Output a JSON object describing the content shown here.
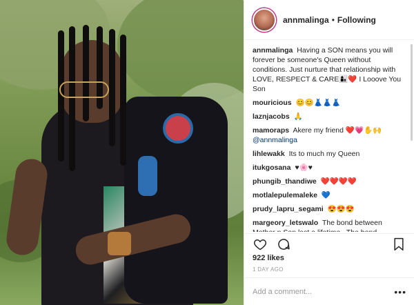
{
  "post": {
    "username": "annmalinga",
    "separator": "•",
    "follow_label": "Following",
    "likes": "922 likes",
    "time": "1 DAY AGO",
    "add_comment_placeholder": "Add a comment...",
    "more_label": "•••"
  },
  "comments": [
    {
      "user": "annmalinga",
      "text": "Having a SON means you will forever be someone's Queen without conditions. Just nurture that relationship with LOVE, RESPECT & CARE👩‍👦❤️ I Looove You Son"
    },
    {
      "user": "mouricious",
      "text": "😊😊👗👗👗"
    },
    {
      "user": "laznjacobs",
      "text": "🙏"
    },
    {
      "user": "mamoraps",
      "text": "Akere my friend ❤️💗✋🙌",
      "mention": "@annmalinga"
    },
    {
      "user": "lihlewakk",
      "text": "Its to much my Queen"
    },
    {
      "user": "itukgosana",
      "text": "♥🌸♥"
    },
    {
      "user": "phungib_thandiwe",
      "text": "❤️❤️❤️❤️"
    },
    {
      "user": "motlalepulemaleke",
      "text": "💙"
    },
    {
      "user": "prudy_lapru_segami",
      "text": "😍😍😍"
    },
    {
      "user": "margeory_letswalo",
      "text": "The bond between Mother n Son last a lifetime . The bond between Mother n Son is a special one🙏"
    }
  ],
  "icons": {
    "heart": "heart-icon",
    "comment": "comment-icon",
    "bookmark": "bookmark-icon"
  },
  "colors": {
    "link": "#003569",
    "ring": "#c13584"
  }
}
